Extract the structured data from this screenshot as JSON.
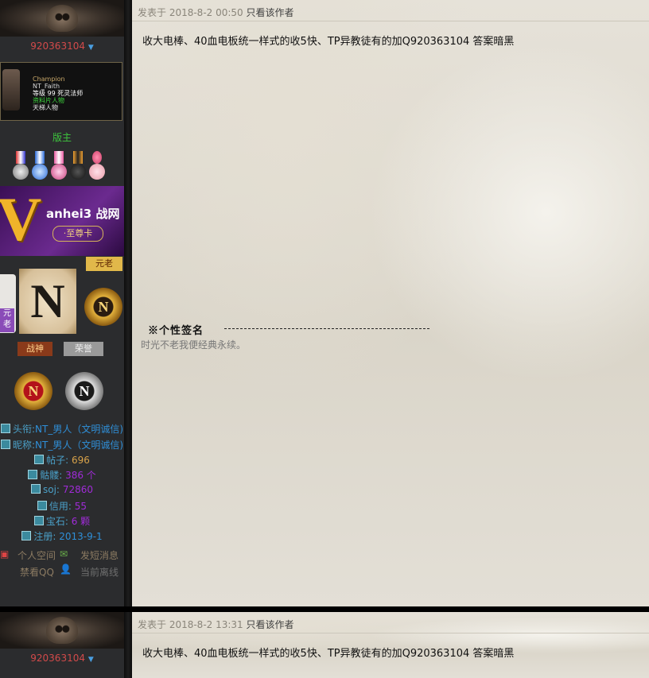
{
  "posts": [
    {
      "author": {
        "username": "920363104",
        "role": "版主",
        "character": {
          "line1": "Champion",
          "line2": "NT_Faith",
          "line3": "等级 99 死灵法师",
          "line4": "资料片人物",
          "line5": "天梯人物"
        },
        "vip_banner": {
          "text": "anhei3 战网",
          "card": "·至尊卡"
        },
        "badges": {
          "elder": "元老",
          "war_god": "战神",
          "honor": "荣誉",
          "elder_small": "元老"
        },
        "info": {
          "title_label": "头衔:",
          "title_value": "NT_男人（文明诚信)",
          "nick_label": "昵称:",
          "nick_value": "NT_男人（文明诚信)",
          "posts_label": "帖子:",
          "posts_value": "696",
          "skulls_label": "骷髅:",
          "skulls_value": "386 个",
          "soj_label": "soj:",
          "soj_value": "72860",
          "credit_label": "信用:",
          "credit_value": "55",
          "gems_label": "宝石:",
          "gems_value": "6 颗",
          "reg_label": "注册:",
          "reg_value": "2013-9-1"
        },
        "links": {
          "space": "个人空间",
          "message": "发短消息",
          "ban": "禁看QQ",
          "status": "当前离线"
        }
      },
      "meta": {
        "posted": "发表于 2018-8-2 00:50",
        "only_author": "只看该作者"
      },
      "body": "收大电棒、40血电板统一样式的收5快、TP异教徒有的加Q920363104  答案暗黑",
      "signature": {
        "title": "※个性签名",
        "text": "时光不老我便经典永续。"
      }
    },
    {
      "author": {
        "username": "920363104"
      },
      "meta": {
        "posted": "发表于 2018-8-2 13:31",
        "only_author": "只看该作者"
      },
      "body": "收大电棒、40血电板统一样式的收5快、TP异教徒有的加Q920363104  答案暗黑"
    }
  ],
  "icons": {
    "dropdown": "chevron-down-icon",
    "info": "info-icon",
    "space": "home-icon",
    "message": "mail-icon",
    "status": "user-icon"
  },
  "colors": {
    "username": "#d24a4a",
    "role": "#3ec63e",
    "info_label": "#4aa0c8",
    "info_value_blue": "#2f8fd8",
    "info_value_gold": "#d8a24a",
    "info_value_purple": "#a02bd8",
    "sidebar_bg": "#2b2c2e",
    "content_bg": "#e2ded4"
  }
}
